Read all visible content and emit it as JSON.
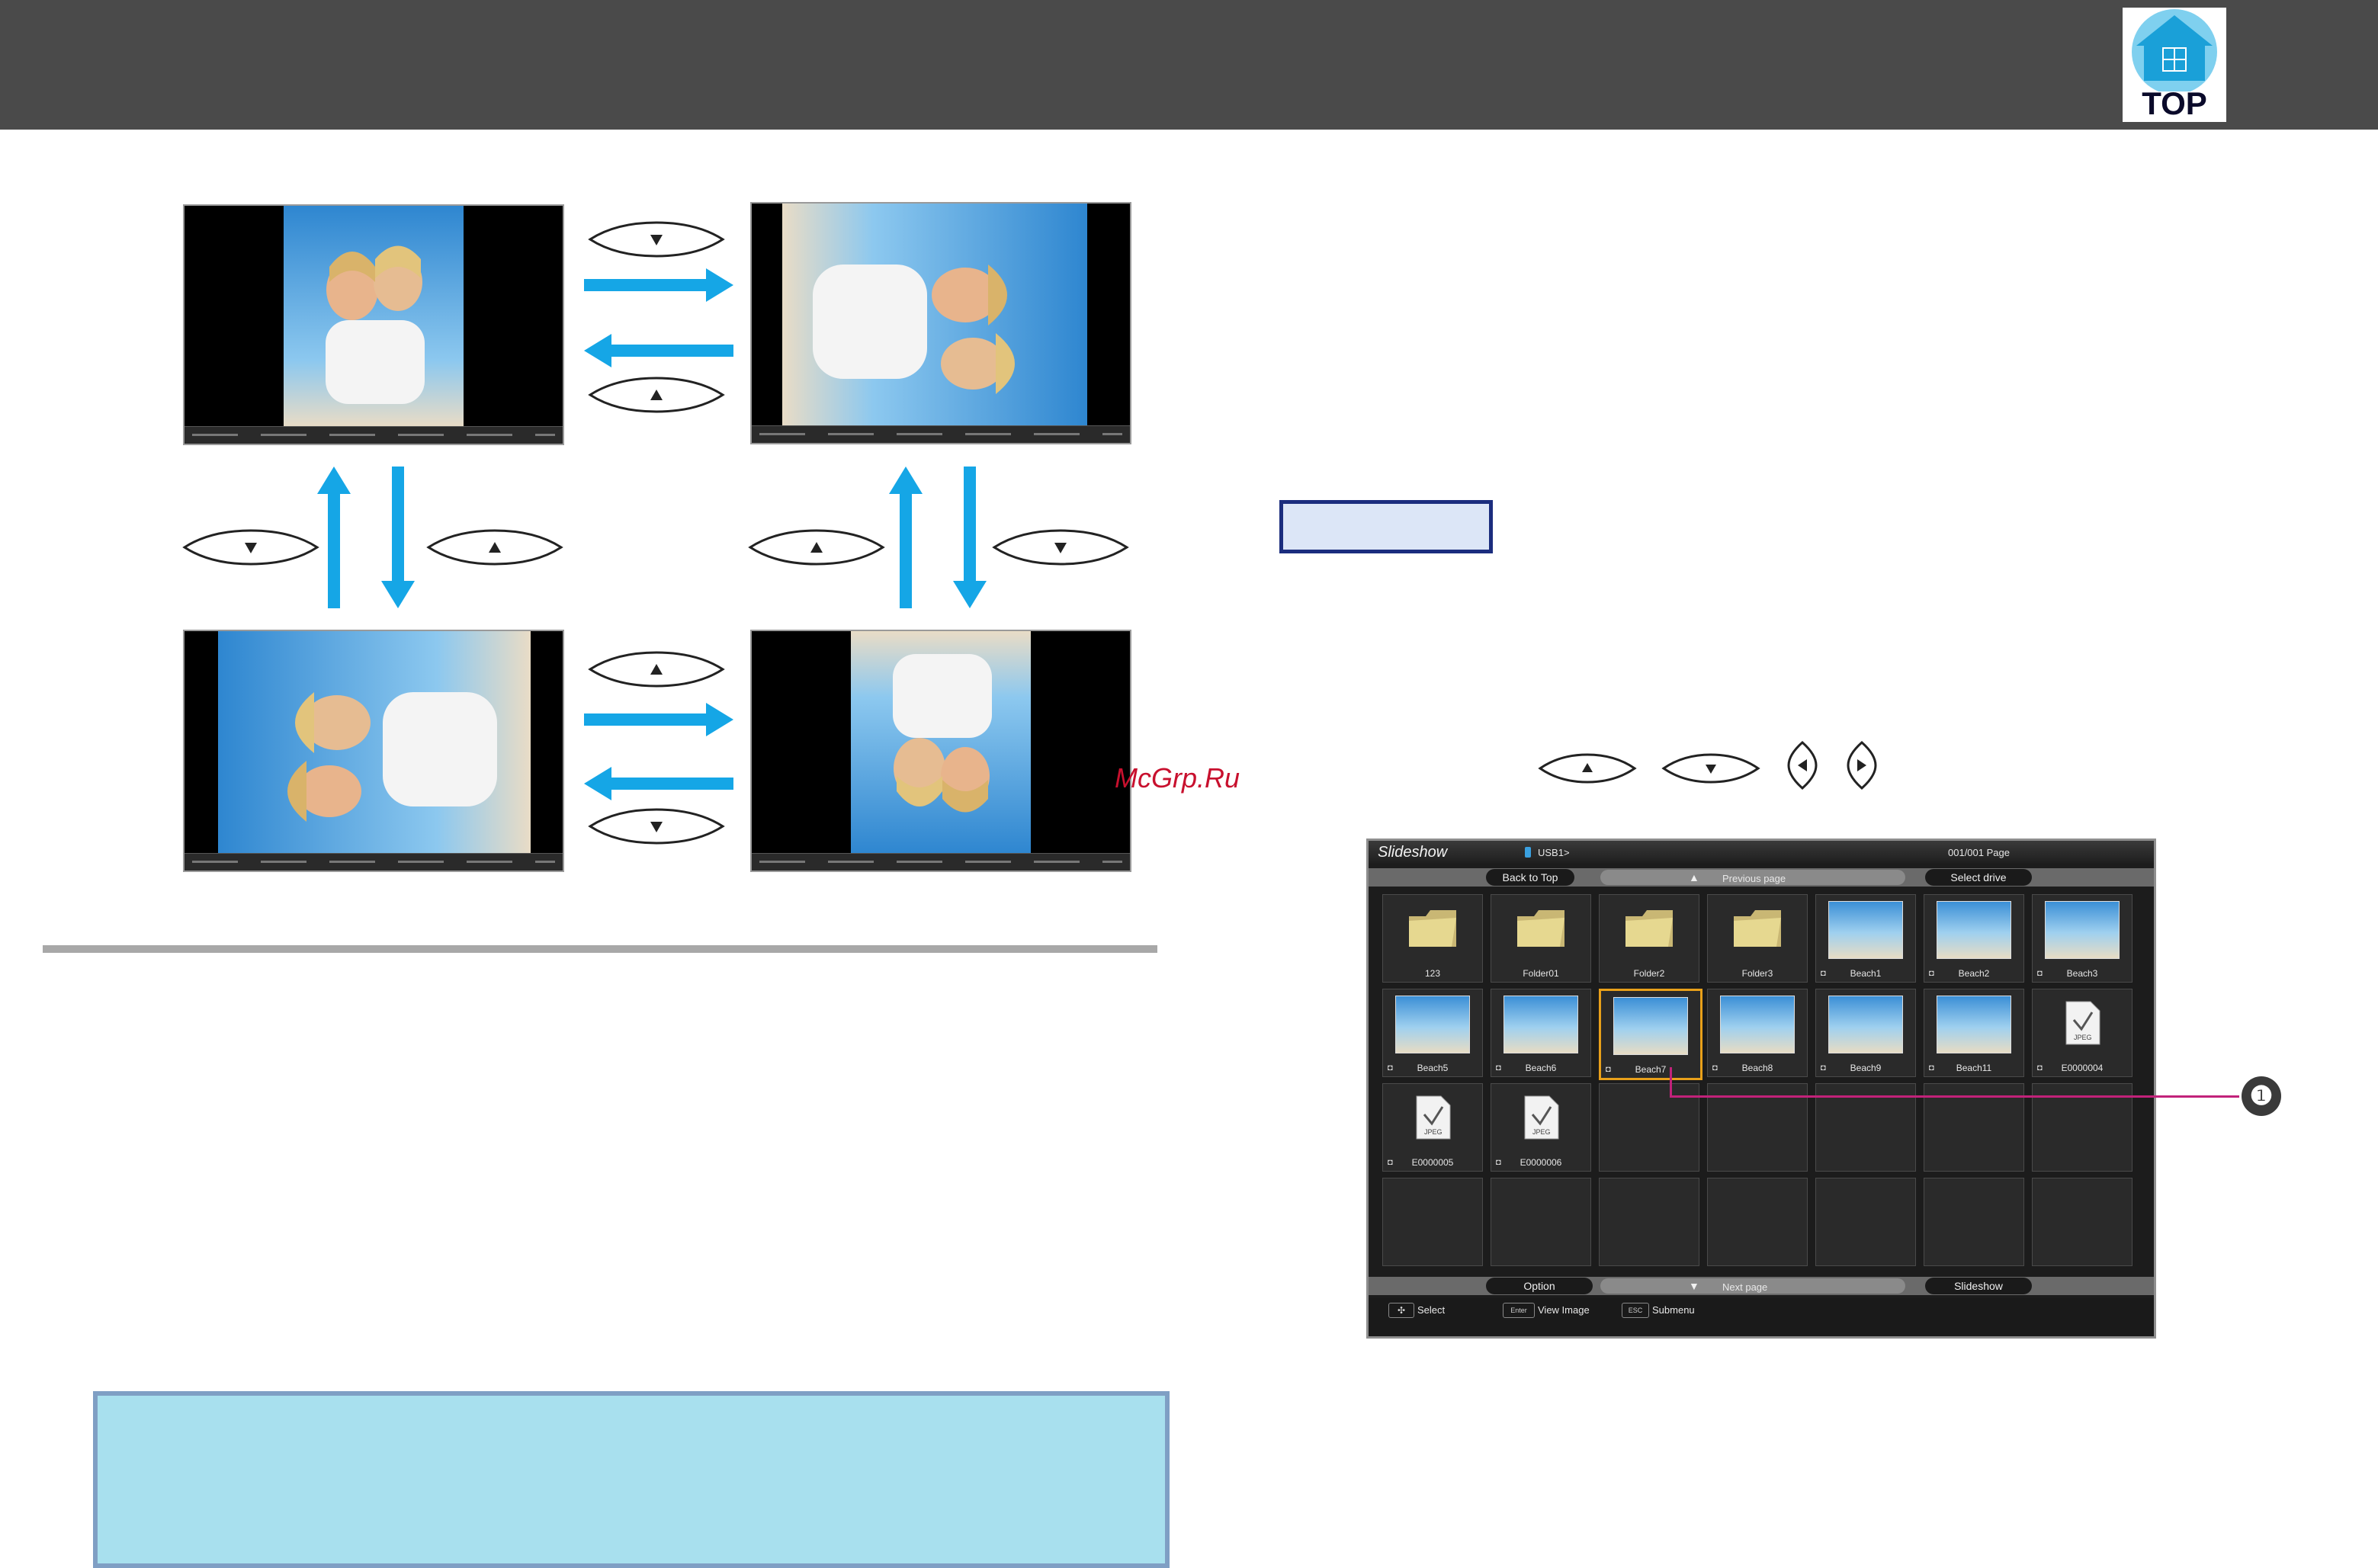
{
  "header": {
    "top_logo_text": "TOP"
  },
  "watermark": "McGrp.Ru",
  "slideshow": {
    "title": "Slideshow",
    "drive": "USB1>",
    "page_counter": "001/001 Page",
    "back_to_top": "Back to Top",
    "previous_page": "Previous page",
    "select_drive": "Select drive",
    "option": "Option",
    "next_page": "Next page",
    "slideshow_button": "Slideshow",
    "key_select": "Select",
    "key_enter": "Enter",
    "key_view_image": "View Image",
    "key_esc": "ESC",
    "key_submenu": "Submenu",
    "items": [
      {
        "label": "123",
        "type": "folder"
      },
      {
        "label": "Folder01",
        "type": "folder"
      },
      {
        "label": "Folder2",
        "type": "folder"
      },
      {
        "label": "Folder3",
        "type": "folder"
      },
      {
        "label": "Beach1",
        "type": "photo"
      },
      {
        "label": "Beach2",
        "type": "photo"
      },
      {
        "label": "Beach3",
        "type": "photo"
      },
      {
        "label": "Beach5",
        "type": "photo"
      },
      {
        "label": "Beach6",
        "type": "photo"
      },
      {
        "label": "Beach7",
        "type": "photo"
      },
      {
        "label": "Beach8",
        "type": "photo"
      },
      {
        "label": "Beach9",
        "type": "photo"
      },
      {
        "label": "Beach11",
        "type": "photo"
      },
      {
        "label": "E0000004",
        "type": "jpeg"
      },
      {
        "label": "E0000005",
        "type": "jpeg"
      },
      {
        "label": "E0000006",
        "type": "jpeg"
      }
    ],
    "selected_index": 9
  },
  "callout_number": "❶",
  "colors": {
    "header_bg": "#4a4a4a",
    "arrow_blue": "#15a6e6",
    "note_bg": "#a8e0ee",
    "callout_line": "#c2227a"
  }
}
